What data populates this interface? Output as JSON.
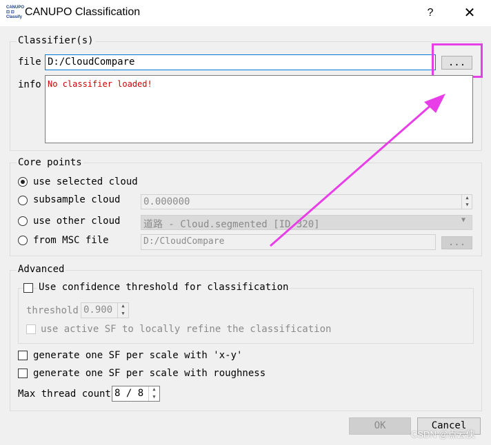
{
  "window": {
    "title": "CANUPO Classification",
    "help": "?",
    "close": "✕",
    "icon_lines": [
      "CANUPO",
      "⊡ ⊡",
      "Classify"
    ]
  },
  "classifier": {
    "legend": "Classifier(s)",
    "file_label": "file",
    "file_value": "D:/CloudCompare",
    "browse_label": "...",
    "info_label": "info",
    "info_text": "No classifier loaded!"
  },
  "core_points": {
    "legend": "Core points",
    "use_selected": "use selected cloud",
    "subsample": "subsample cloud",
    "subsample_value": "0.000000",
    "use_other": "use other cloud",
    "other_value": "道路 - Cloud.segmented [ID 320]",
    "from_msc": "from MSC file",
    "msc_value": "D:/CloudCompare",
    "msc_browse": "..."
  },
  "advanced": {
    "legend": "Advanced",
    "use_confidence": "Use confidence threshold for classification",
    "threshold_label": "threshold",
    "threshold_value": "0.900",
    "use_active_sf": "use active SF to locally refine the classification",
    "gen_xy": "generate one SF per scale with 'x-y'",
    "gen_roughness": "generate one SF per scale with roughness",
    "max_thread_label": "Max thread count",
    "max_thread_value": "8 / 8"
  },
  "buttons": {
    "ok": "OK",
    "cancel": "Cancel"
  },
  "watermark": "CSDN @点云侠",
  "colors": {
    "annotation": "#e83ee8",
    "error_text": "#cc0000"
  }
}
